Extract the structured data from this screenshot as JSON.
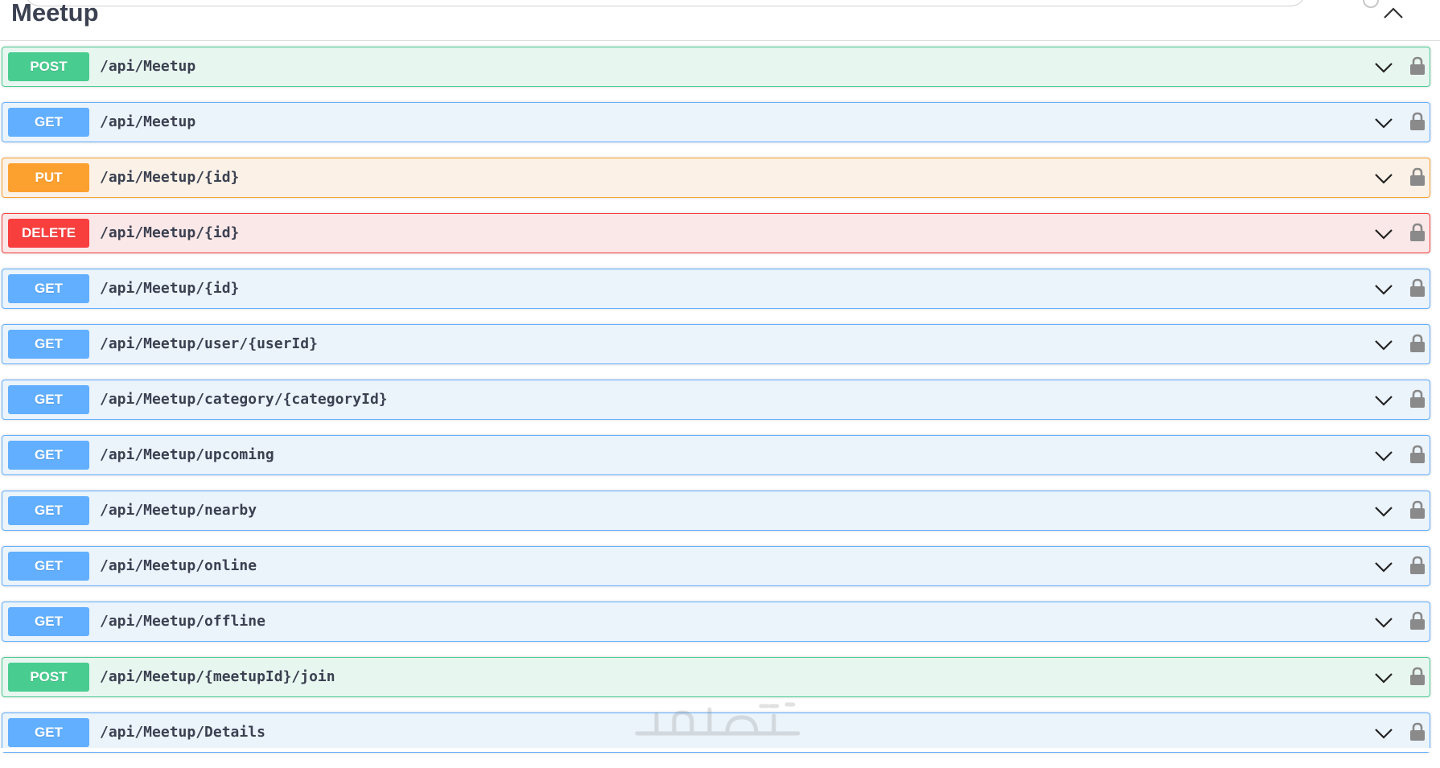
{
  "section": {
    "title": "Meetup",
    "toggle_icon": "chevron-up-icon"
  },
  "operations": [
    {
      "method": "POST",
      "path": "/api/Meetup"
    },
    {
      "method": "GET",
      "path": "/api/Meetup"
    },
    {
      "method": "PUT",
      "path": "/api/Meetup/{id}"
    },
    {
      "method": "DELETE",
      "path": "/api/Meetup/{id}"
    },
    {
      "method": "GET",
      "path": "/api/Meetup/{id}"
    },
    {
      "method": "GET",
      "path": "/api/Meetup/user/{userId}"
    },
    {
      "method": "GET",
      "path": "/api/Meetup/category/{categoryId}"
    },
    {
      "method": "GET",
      "path": "/api/Meetup/upcoming"
    },
    {
      "method": "GET",
      "path": "/api/Meetup/nearby"
    },
    {
      "method": "GET",
      "path": "/api/Meetup/online"
    },
    {
      "method": "GET",
      "path": "/api/Meetup/offline"
    },
    {
      "method": "POST",
      "path": "/api/Meetup/{meetupId}/join"
    },
    {
      "method": "GET",
      "path": "/api/Meetup/Details"
    }
  ],
  "colors": {
    "post": "#49cc90",
    "get": "#61affe",
    "put": "#fca130",
    "delete": "#f93e3e",
    "text": "#3b4151"
  },
  "icons": {
    "expand": "chevron-down-icon",
    "auth": "lock-icon",
    "watermark": "watermark-logo"
  },
  "watermark_text": "خمسات"
}
